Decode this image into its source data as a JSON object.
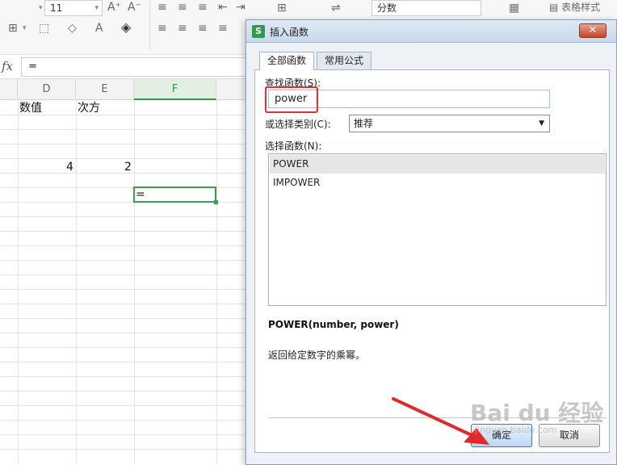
{
  "toolbar": {
    "font_size": "11",
    "number_format": "分数",
    "table_style_label": "表格样式"
  },
  "formula_bar": {
    "fx_label": "fx",
    "value": "="
  },
  "sheet": {
    "columns": [
      "D",
      "E",
      "F"
    ],
    "active_column": "F",
    "cells": {
      "d1": "数值",
      "e1": "次方",
      "d5": "4",
      "e5": "2",
      "f7": "="
    }
  },
  "dialog": {
    "title": "插入函数",
    "close_glyph": "✕",
    "tabs": [
      "全部函数",
      "常用公式"
    ],
    "search_label": "查找函数(S):",
    "search_value": "power",
    "category_label": "或选择类别(C):",
    "category_value": "推荐",
    "select_label": "选择函数(N):",
    "functions": [
      "POWER",
      "IMPOWER"
    ],
    "selected_function": "POWER",
    "signature": "POWER(number, power)",
    "description": "返回给定数字的乘幂。",
    "ok_label": "确定",
    "cancel_label": "取消"
  },
  "annotation": {
    "highlight_color": "#e33131",
    "arrow_color": "#e02a2a"
  },
  "watermark": {
    "main": "Bai du 经验",
    "sub": "jingyan.baidu.com"
  }
}
